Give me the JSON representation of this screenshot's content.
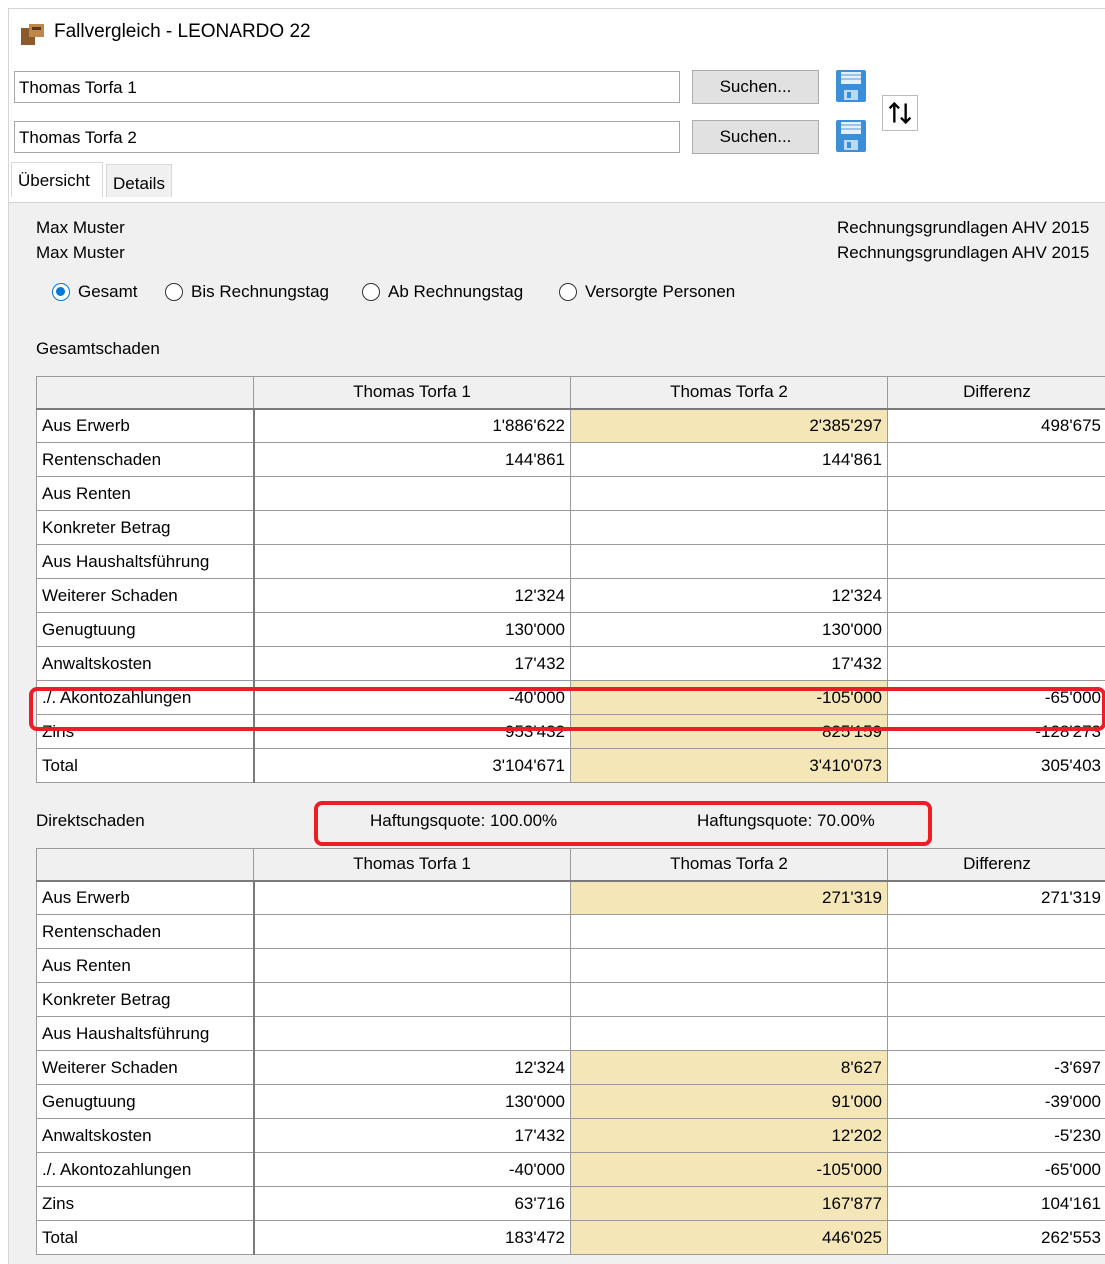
{
  "window": {
    "title": "Fallvergleich - LEONARDO 22"
  },
  "cases": [
    {
      "value": "Thomas Torfa 1",
      "search_label": "Suchen..."
    },
    {
      "value": "Thomas Torfa 2",
      "search_label": "Suchen..."
    }
  ],
  "tabs": [
    {
      "label": "Übersicht",
      "active": true
    },
    {
      "label": "Details",
      "active": false
    }
  ],
  "info": {
    "person1": "Max Muster",
    "person2": "Max Muster",
    "basis1": "Rechnungsgrundlagen AHV 2015",
    "basis2": "Rechnungsgrundlagen AHV 2015"
  },
  "radios": [
    {
      "label": "Gesamt",
      "selected": true
    },
    {
      "label": "Bis Rechnungstag",
      "selected": false
    },
    {
      "label": "Ab Rechnungstag",
      "selected": false
    },
    {
      "label": "Versorgte Personen",
      "selected": false
    }
  ],
  "columns": [
    "",
    "Thomas Torfa 1",
    "Thomas Torfa 2",
    "Differenz"
  ],
  "gesamt": {
    "label": "Gesamtschaden",
    "rows": [
      {
        "label": "Aus Erwerb",
        "c1": "1'886'622",
        "c2": "2'385'297",
        "diff": "498'675",
        "hl": true
      },
      {
        "label": "Rentenschaden",
        "c1": "144'861",
        "c2": "144'861",
        "diff": "",
        "hl": false
      },
      {
        "label": "Aus Renten",
        "c1": "",
        "c2": "",
        "diff": "",
        "hl": false
      },
      {
        "label": "Konkreter Betrag",
        "c1": "",
        "c2": "",
        "diff": "",
        "hl": false
      },
      {
        "label": "Aus Haushaltsführung",
        "c1": "",
        "c2": "",
        "diff": "",
        "hl": false
      },
      {
        "label": "Weiterer Schaden",
        "c1": "12'324",
        "c2": "12'324",
        "diff": "",
        "hl": false
      },
      {
        "label": "Genugtuung",
        "c1": "130'000",
        "c2": "130'000",
        "diff": "",
        "hl": false
      },
      {
        "label": "Anwaltskosten",
        "c1": "17'432",
        "c2": "17'432",
        "diff": "",
        "hl": false
      },
      {
        "label": "./. Akontozahlungen",
        "c1": "-40'000",
        "c2": "-105'000",
        "diff": "-65'000",
        "hl": true
      },
      {
        "label": "Zins",
        "c1": "953'432",
        "c2": "825'159",
        "diff": "-128'273",
        "hl": true
      },
      {
        "label": "Total",
        "c1": "3'104'671",
        "c2": "3'410'073",
        "diff": "305'403",
        "hl": true
      }
    ]
  },
  "direkt": {
    "label": "Direktschaden",
    "haftung1": "Haftungsquote: 100.00%",
    "haftung2": "Haftungsquote: 70.00%",
    "rows": [
      {
        "label": "Aus Erwerb",
        "c1": "",
        "c2": "271'319",
        "diff": "271'319",
        "hl": true
      },
      {
        "label": "Rentenschaden",
        "c1": "",
        "c2": "",
        "diff": "",
        "hl": false
      },
      {
        "label": "Aus Renten",
        "c1": "",
        "c2": "",
        "diff": "",
        "hl": false
      },
      {
        "label": "Konkreter Betrag",
        "c1": "",
        "c2": "",
        "diff": "",
        "hl": false
      },
      {
        "label": "Aus Haushaltsführung",
        "c1": "",
        "c2": "",
        "diff": "",
        "hl": false
      },
      {
        "label": "Weiterer Schaden",
        "c1": "12'324",
        "c2": "8'627",
        "diff": "-3'697",
        "hl": true
      },
      {
        "label": "Genugtuung",
        "c1": "130'000",
        "c2": "91'000",
        "diff": "-39'000",
        "hl": true
      },
      {
        "label": "Anwaltskosten",
        "c1": "17'432",
        "c2": "12'202",
        "diff": "-5'230",
        "hl": true
      },
      {
        "label": "./. Akontozahlungen",
        "c1": "-40'000",
        "c2": "-105'000",
        "diff": "-65'000",
        "hl": true
      },
      {
        "label": "Zins",
        "c1": "63'716",
        "c2": "167'877",
        "diff": "104'161",
        "hl": true
      },
      {
        "label": "Total",
        "c1": "183'472",
        "c2": "446'025",
        "diff": "262'553",
        "hl": true
      }
    ]
  },
  "icons": {
    "app": "leonardo-app-icon",
    "save": "floppy-disk-icon",
    "swap": "swap-up-down-icon"
  },
  "colors": {
    "highlight": "#f5e6b8",
    "accent": "#0078d7",
    "annotation": "#ee1c24"
  }
}
